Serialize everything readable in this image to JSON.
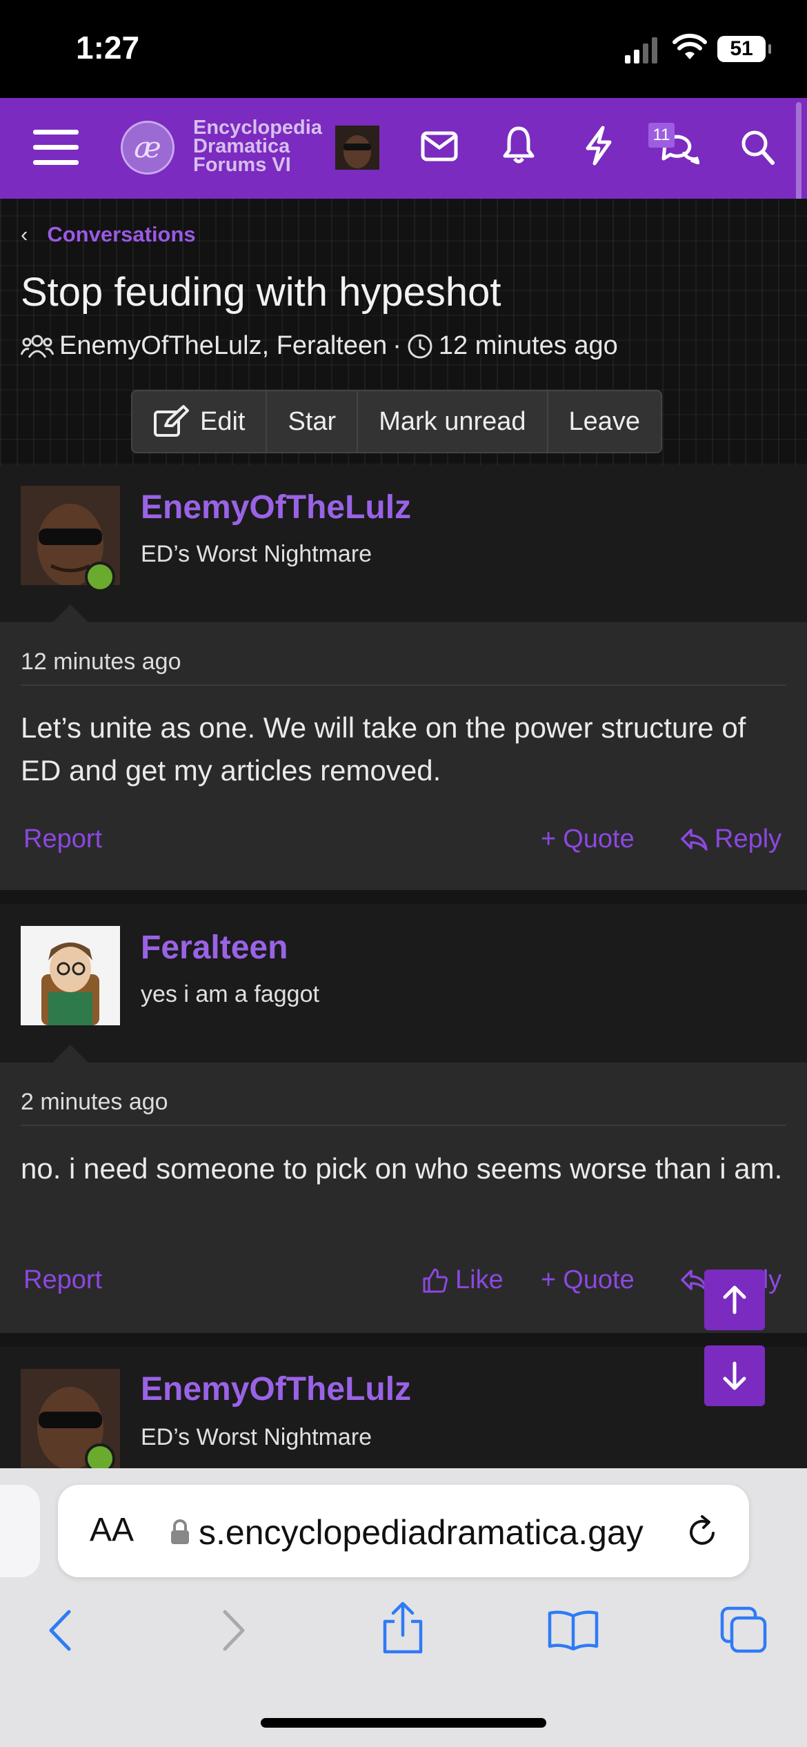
{
  "status_bar": {
    "time": "1:27",
    "battery": "51"
  },
  "header": {
    "logo_lines": [
      "Encyclopedia",
      "Dramatica",
      "Forums VI"
    ],
    "notification_badge": "11"
  },
  "breadcrumb": {
    "label": "Conversations"
  },
  "conversation": {
    "title": "Stop feuding with hypeshot",
    "participants": "EnemyOfTheLulz, Feralteen",
    "separator": "·",
    "time": "12 minutes ago"
  },
  "toolbar": {
    "edit": "Edit",
    "star": "Star",
    "mark_unread": "Mark unread",
    "leave": "Leave"
  },
  "messages": [
    {
      "username": "EnemyOfTheLulz",
      "user_title": "ED’s Worst Nightmare",
      "time": "12 minutes ago",
      "text": "Let’s unite as one. We will take on the power structure of ED and get my articles removed.",
      "report": "Report",
      "quote": "Quote",
      "reply": "Reply"
    },
    {
      "username": "Feralteen",
      "user_title": "yes i am a faggot",
      "time": "2 minutes ago",
      "text": "no. i need someone to pick on who seems worse than i am.",
      "report": "Report",
      "like": "Like",
      "quote": "Quote",
      "reply": "Reply"
    },
    {
      "username": "EnemyOfTheLulz",
      "user_title": "ED’s Worst Nightmare"
    }
  ],
  "browser": {
    "text_size_label": "AA",
    "url": "s.encyclopediadramatica.gay"
  },
  "colors": {
    "accent": "#7b2bbf",
    "link": "#8c48e0",
    "username": "#9a63e6"
  }
}
